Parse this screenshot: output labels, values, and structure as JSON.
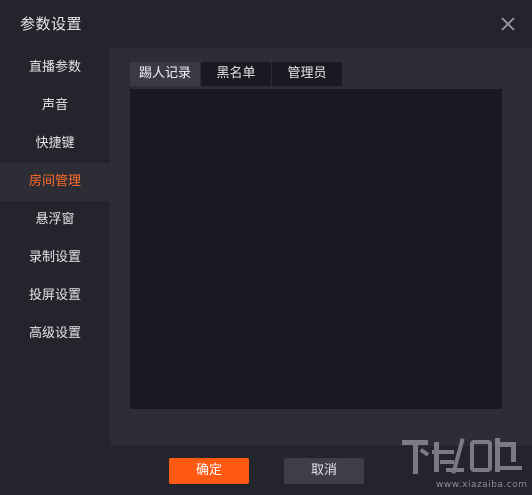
{
  "window": {
    "title": "参数设置",
    "close_icon": "close-icon"
  },
  "sidebar": {
    "active_color": "#ff6a2a",
    "items": [
      {
        "label": "直播参数"
      },
      {
        "label": "声音"
      },
      {
        "label": "快捷键"
      },
      {
        "label": "房间管理",
        "active": true
      },
      {
        "label": "悬浮窗"
      },
      {
        "label": "录制设置"
      },
      {
        "label": "投屏设置"
      },
      {
        "label": "高级设置"
      }
    ]
  },
  "main": {
    "tabs": [
      {
        "label": "踢人记录",
        "active": true
      },
      {
        "label": "黑名单"
      },
      {
        "label": "管理员"
      }
    ]
  },
  "footer": {
    "confirm_label": "确定",
    "cancel_label": "取消",
    "confirm_color": "#ff5a14"
  },
  "watermark": {
    "logo_icon": "xiazaiba-logo-icon",
    "text": "www.xiazaiba.com"
  }
}
